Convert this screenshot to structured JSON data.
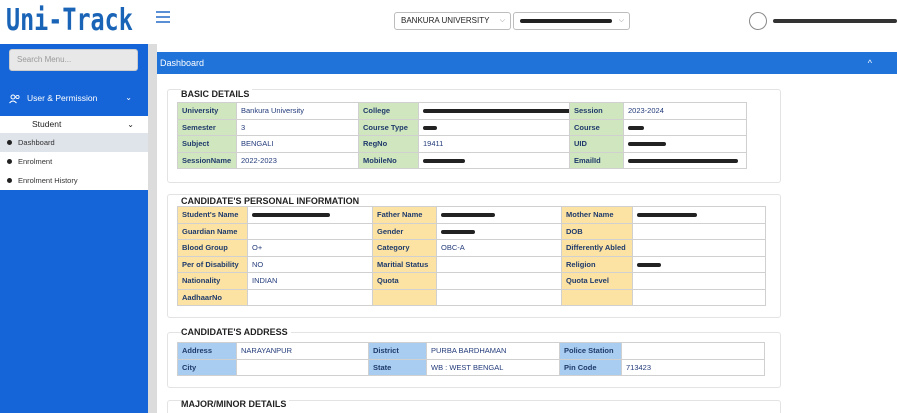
{
  "app": {
    "logo": "Uni-Track"
  },
  "header": {
    "university_select": "BANKURA UNIVERSITY",
    "chevron": "⌵"
  },
  "sidebar": {
    "search_placeholder": "Search Menu...",
    "user_permission": "User & Permission",
    "student": "Student",
    "items": [
      {
        "label": "Dashboard",
        "active": true
      },
      {
        "label": "Enrolment",
        "active": false
      },
      {
        "label": "Enrolment History",
        "active": false
      }
    ]
  },
  "main": {
    "title": "Dashboard",
    "collapse_icon": "^",
    "basic": {
      "title": "BASIC DETAILS",
      "rows": [
        [
          {
            "k": "University"
          },
          {
            "v": "Bankura University"
          },
          {
            "k": "College"
          },
          {
            "v": ""
          },
          {
            "k": "Session"
          },
          {
            "v": "2023-2024"
          }
        ],
        [
          {
            "k": "Semester"
          },
          {
            "v": "3"
          },
          {
            "k": "Course Type"
          },
          {
            "v": ""
          },
          {
            "k": "Course"
          },
          {
            "v": ""
          }
        ],
        [
          {
            "k": "Subject"
          },
          {
            "v": "BENGALI"
          },
          {
            "k": "RegNo"
          },
          {
            "v": "19411"
          },
          {
            "k": "UID"
          },
          {
            "v": ""
          }
        ],
        [
          {
            "k": "SessionName"
          },
          {
            "v": "2022-2023"
          },
          {
            "k": "MobileNo"
          },
          {
            "v": ""
          },
          {
            "k": "EmailId"
          },
          {
            "v": ""
          }
        ]
      ]
    },
    "personal": {
      "title": "CANDIDATE'S PERSONAL INFORMATION",
      "rows": [
        [
          {
            "k": "Student's Name"
          },
          {
            "v": ""
          },
          {
            "k": "Father Name"
          },
          {
            "v": ""
          },
          {
            "k": "Mother Name"
          },
          {
            "v": ""
          }
        ],
        [
          {
            "k": "Guardian Name"
          },
          {
            "v": ""
          },
          {
            "k": "Gender"
          },
          {
            "v": ""
          },
          {
            "k": "DOB"
          },
          {
            "v": ""
          }
        ],
        [
          {
            "k": "Blood Group"
          },
          {
            "v": "O+"
          },
          {
            "k": "Category"
          },
          {
            "v": "OBC-A"
          },
          {
            "k": "Differently Abled"
          },
          {
            "v": ""
          }
        ],
        [
          {
            "k": "Per of Disability"
          },
          {
            "v": "NO"
          },
          {
            "k": "Maritial Status"
          },
          {
            "v": ""
          },
          {
            "k": "Religion"
          },
          {
            "v": ""
          }
        ],
        [
          {
            "k": "Nationality"
          },
          {
            "v": "INDIAN"
          },
          {
            "k": "Quota"
          },
          {
            "v": ""
          },
          {
            "k": "Quota Level"
          },
          {
            "v": ""
          }
        ],
        [
          {
            "k": "AadhaarNo"
          },
          {
            "v": ""
          },
          {
            "k": ""
          },
          {
            "v": ""
          },
          {
            "k": ""
          },
          {
            "v": ""
          }
        ]
      ]
    },
    "address": {
      "title": "CANDIDATE'S ADDRESS",
      "rows": [
        [
          {
            "k": "Address"
          },
          {
            "v": "NARAYANPUR"
          },
          {
            "k": "District"
          },
          {
            "v": "PURBA BARDHAMAN"
          },
          {
            "k": "Police Station"
          },
          {
            "v": ""
          }
        ],
        [
          {
            "k": "City"
          },
          {
            "v": ""
          },
          {
            "k": "State"
          },
          {
            "v": "WB : WEST BENGAL"
          },
          {
            "k": "Pin Code"
          },
          {
            "v": "713423"
          }
        ]
      ]
    },
    "major_minor": {
      "title": "MAJOR/MINOR DETAILS"
    }
  }
}
